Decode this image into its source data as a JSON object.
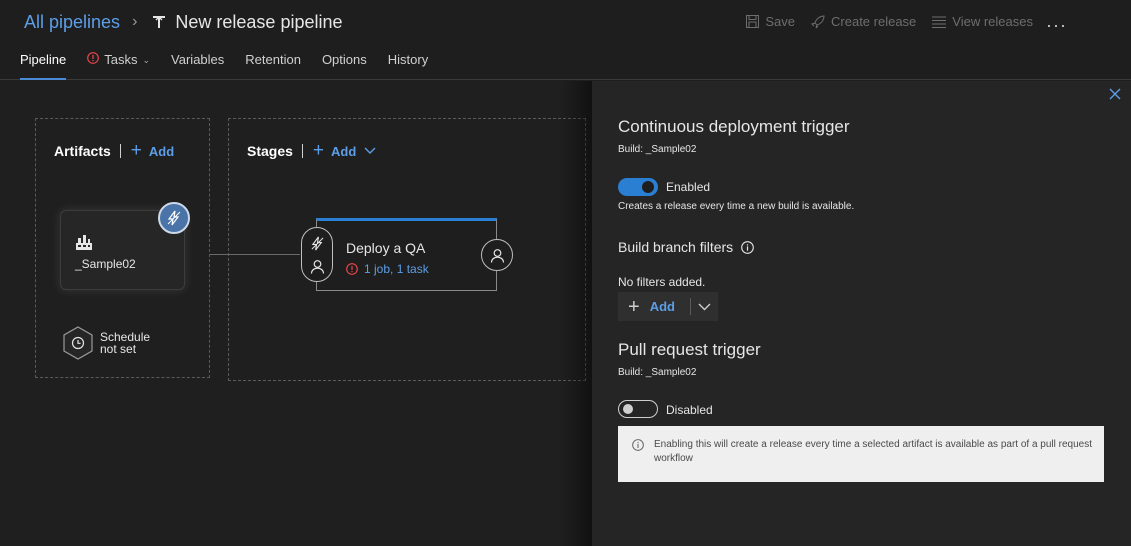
{
  "breadcrumb": {
    "parent": "All pipelines",
    "title": "New release pipeline"
  },
  "toolbar": {
    "save": "Save",
    "create_release": "Create release",
    "view_releases": "View releases",
    "more": "···"
  },
  "tabs": [
    {
      "label": "Pipeline"
    },
    {
      "label": "Tasks"
    },
    {
      "label": "Variables"
    },
    {
      "label": "Retention"
    },
    {
      "label": "Options"
    },
    {
      "label": "History"
    }
  ],
  "artifacts": {
    "heading": "Artifacts",
    "add_label": "Add",
    "artifact_name": "_Sample02",
    "schedule_line1": "Schedule",
    "schedule_line2": "not set"
  },
  "stages": {
    "heading": "Stages",
    "add_label": "Add",
    "stage_name": "Deploy a QA",
    "stage_summary": "1 job, 1 task"
  },
  "panel": {
    "cd_title": "Continuous deployment trigger",
    "cd_build": "Build: _Sample02",
    "cd_toggle_label": "Enabled",
    "cd_toggle_on": true,
    "cd_description": "Creates a release every time a new build is available.",
    "branch_filters_heading": "Build branch filters",
    "no_filters": "No filters added.",
    "filter_add_label": "Add",
    "pr_title": "Pull request trigger",
    "pr_build": "Build: _Sample02",
    "pr_toggle_label": "Disabled",
    "pr_toggle_on": false,
    "pr_info": "Enabling this will create a release every time a selected artifact is available as part of a pull request workflow"
  },
  "colors": {
    "accent": "#2b7fd3",
    "link": "#5c9ee8",
    "warning": "#e8454b",
    "background": "#1e1e1e",
    "panel": "#252526"
  }
}
